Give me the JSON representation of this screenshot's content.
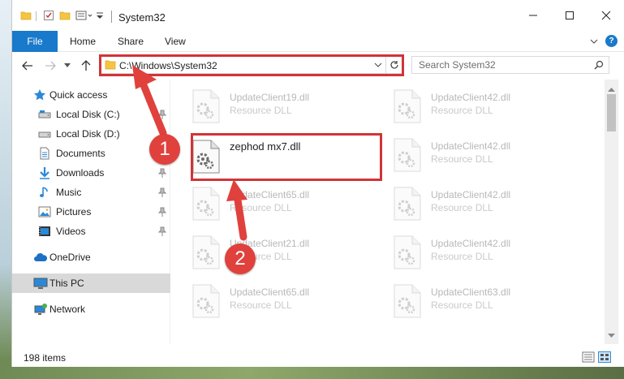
{
  "window": {
    "title": "System32"
  },
  "ribbon": {
    "file": "File",
    "tabs": [
      "Home",
      "Share",
      "View"
    ],
    "help": "?"
  },
  "address": {
    "path": "C:\\Windows\\System32"
  },
  "search": {
    "placeholder": "Search System32"
  },
  "sidebar": {
    "items": [
      {
        "label": "Quick access",
        "icon": "star-icon",
        "pinned": false
      },
      {
        "label": "Local Disk (C:)",
        "icon": "drive-icon",
        "pinned": true
      },
      {
        "label": "Local Disk (D:)",
        "icon": "drive-icon",
        "pinned": false
      },
      {
        "label": "Documents",
        "icon": "document-icon",
        "pinned": true
      },
      {
        "label": "Downloads",
        "icon": "download-icon",
        "pinned": true
      },
      {
        "label": "Music",
        "icon": "music-icon",
        "pinned": true
      },
      {
        "label": "Pictures",
        "icon": "pictures-icon",
        "pinned": true
      },
      {
        "label": "Videos",
        "icon": "video-icon",
        "pinned": true
      },
      {
        "label": "OneDrive",
        "icon": "cloud-icon",
        "pinned": false
      },
      {
        "label": "This PC",
        "icon": "computer-icon",
        "pinned": false
      },
      {
        "label": "Network",
        "icon": "network-icon",
        "pinned": false
      }
    ]
  },
  "files": {
    "highlighted": {
      "name": "zephod mx7.dll"
    },
    "left": [
      {
        "name": "UpdateClient19.dll",
        "type": "Resource DLL"
      },
      {
        "name": "UpdateClient65.dll",
        "type": "Resource DLL"
      },
      {
        "name": "UpdateClient21.dll",
        "type": "Resource DLL"
      },
      {
        "name": "UpdateClient65.dll",
        "type": "Resource DLL"
      }
    ],
    "right": [
      {
        "name": "UpdateClient42.dll",
        "type": "Resource DLL"
      },
      {
        "name": "UpdateClient42.dll",
        "type": "Resource DLL"
      },
      {
        "name": "UpdateClient42.dll",
        "type": "Resource DLL"
      },
      {
        "name": "UpdateClient42.dll",
        "type": "Resource DLL"
      },
      {
        "name": "UpdateClient63.dll",
        "type": "Resource DLL"
      }
    ]
  },
  "status": {
    "count": "198 items"
  },
  "annotations": {
    "step1": "1",
    "step2": "2",
    "color": "#d13438"
  },
  "colors": {
    "accent": "#1979ca",
    "selection": "#cce8ff",
    "annotation": "#e0413c"
  }
}
